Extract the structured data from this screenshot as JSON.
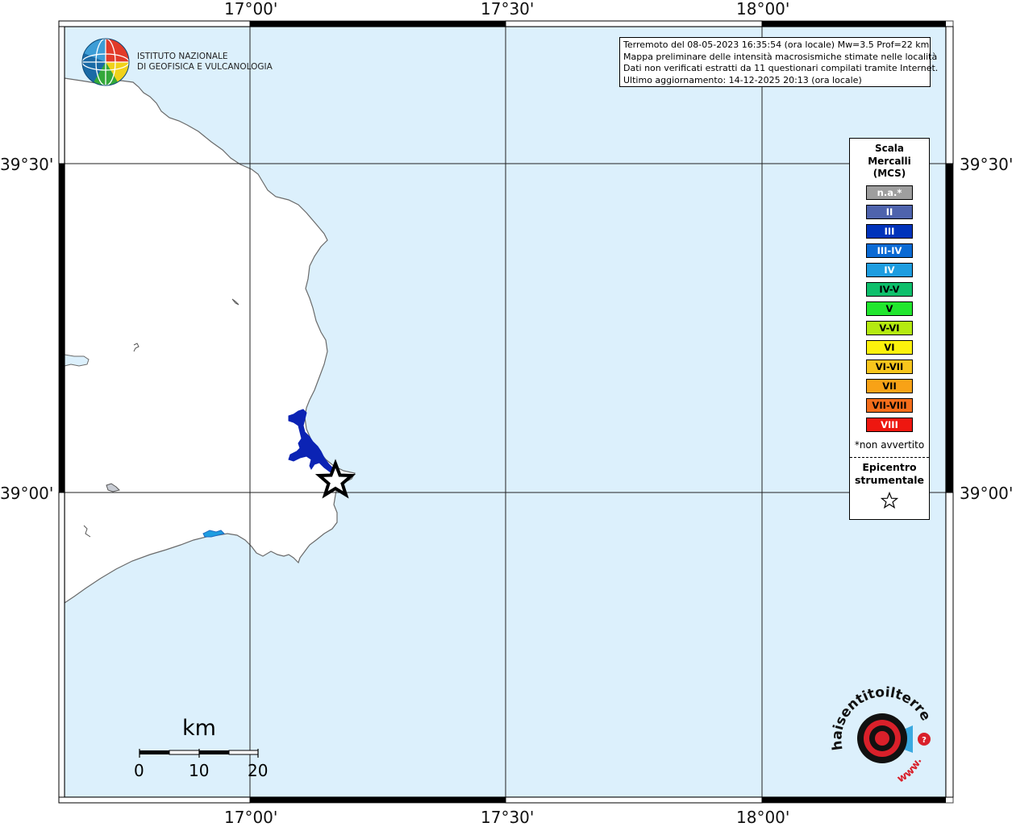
{
  "map": {
    "x_ticks": [
      "17°00'",
      "17°30'",
      "18°00'"
    ],
    "y_ticks": [
      "39°30'",
      "39°00'"
    ]
  },
  "header": {
    "lines": [
      "Terremoto del 08-05-2023 16:35:54 (ora locale) Mw=3.5 Prof=22 km",
      "Mappa preliminare delle intensità macrosismiche stimate nelle località",
      "Dati non verificati estratti da 11 questionari compilati tramite Internet.",
      "Ultimo aggiornamento: 14-12-2025 20:13 (ora locale)"
    ]
  },
  "logo": {
    "line1": "ISTITUTO NAZIONALE",
    "line2": "DI GEOFISICA E VULCANOLOGIA"
  },
  "legend": {
    "title_lines": [
      "Scala",
      "Mercalli",
      "(MCS)"
    ],
    "items": [
      {
        "label": "n.a.*",
        "color": "#9e9e9e",
        "text_color": "#ffffff"
      },
      {
        "label": "II",
        "color": "#4e63ad",
        "text_color": "#ffffff"
      },
      {
        "label": "III",
        "color": "#0033bb",
        "text_color": "#ffffff"
      },
      {
        "label": "III-IV",
        "color": "#0a6ad4",
        "text_color": "#ffffff"
      },
      {
        "label": "IV",
        "color": "#1e9de0",
        "text_color": "#ffffff"
      },
      {
        "label": "IV-V",
        "color": "#0ebf6b",
        "text_color": "#000000"
      },
      {
        "label": "V",
        "color": "#22e62e",
        "text_color": "#000000"
      },
      {
        "label": "V-VI",
        "color": "#b4ea10",
        "text_color": "#000000"
      },
      {
        "label": "VI",
        "color": "#fcf10c",
        "text_color": "#000000"
      },
      {
        "label": "VI-VII",
        "color": "#f8c51c",
        "text_color": "#000000"
      },
      {
        "label": "VII",
        "color": "#f8a216",
        "text_color": "#000000"
      },
      {
        "label": "VII-VIII",
        "color": "#f46d1a",
        "text_color": "#000000"
      },
      {
        "label": "VIII",
        "color": "#ee1710",
        "text_color": "#ffffff"
      }
    ],
    "na_note": "*non avvertito",
    "epicenter_lines": [
      "Epicentro",
      "strumentale"
    ],
    "epicenter_icon": "star-outline-icon"
  },
  "scalebar": {
    "unit": "km",
    "labels": [
      "0",
      "10",
      "20"
    ]
  },
  "badge": {
    "text_main": "haisentitoilterremoto",
    "text_tld": ".it",
    "text_www": "www.",
    "icon": "speaker-target-icon"
  },
  "colors": {
    "sea": "#dcf0fc",
    "land": "#ffffff",
    "lake": "#0b23b4",
    "frame": "#000000"
  }
}
